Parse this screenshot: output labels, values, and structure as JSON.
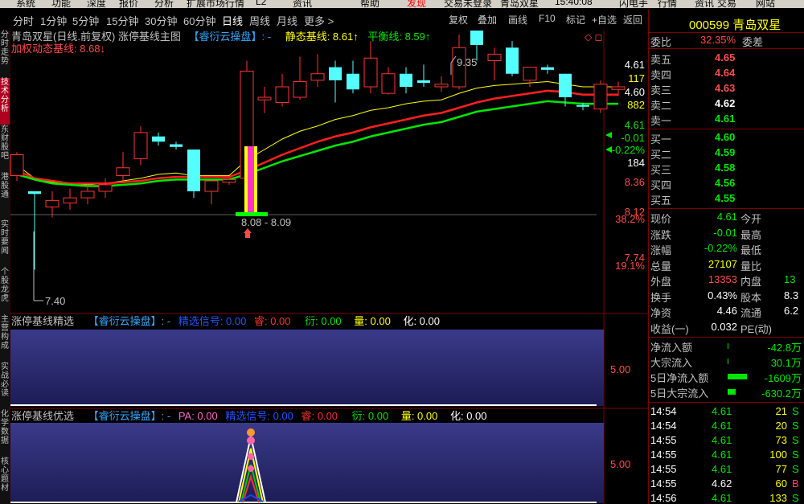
{
  "menu": [
    "系统",
    "功能",
    "深度",
    "报价",
    "分析",
    "扩展市场行情",
    "L2",
    "资讯",
    "帮助",
    "发现",
    "交易未登录",
    "青岛双星",
    "15:40:08",
    "闪电手",
    "行情",
    "资讯",
    "交易",
    "网站"
  ],
  "toolbar": {
    "periods": [
      "分时",
      "1分钟",
      "5分钟",
      "15分钟",
      "30分钟",
      "60分钟",
      "日线",
      "周线",
      "月线",
      "更多 >"
    ],
    "active_period": "日线",
    "right_buttons": [
      "复权",
      "叠加",
      "画线",
      "F10",
      "标记",
      "+自选",
      "返回"
    ]
  },
  "sidebar_tabs": [
    {
      "label": "分时走势",
      "active": false
    },
    {
      "label": "技术分析",
      "active": true
    },
    {
      "label": "东财股吧",
      "active": false
    },
    {
      "label": "港股通",
      "active": false
    },
    {
      "label": "实时要闻",
      "active": false
    },
    {
      "label": "个股龙虎",
      "active": false
    },
    {
      "label": "主营构成",
      "active": false
    },
    {
      "label": "实战必读",
      "active": false
    },
    {
      "label": "化学数据",
      "active": false
    },
    {
      "label": "核心题材",
      "active": false
    }
  ],
  "main_chart": {
    "title_line1": "青岛双星(日线.前复权) 涨停基线主图",
    "indicator_name": "【睿衍云操盘】: -",
    "static_baseline": "静态基线: 8.61↑",
    "balance_line": "平衡线: 8.59↑",
    "title_line2": "加权动态基线: 8.68↓",
    "high_annot": "9.35",
    "low_annot": "7.40",
    "box_annot": "8.08 - 8.09",
    "axis": [
      {
        "text": "4.61",
        "color": "#ffffff"
      },
      {
        "text": "117",
        "color": "#ffff00"
      },
      {
        "text": "4.60",
        "color": "#ffffff"
      },
      {
        "text": "882",
        "color": "#ffff00"
      },
      {
        "text": "4.61",
        "color": "#00e600"
      },
      {
        "text": "-0.01",
        "color": "#00e600"
      },
      {
        "text": "-0.22%",
        "color": "#00e600"
      },
      {
        "text": "184",
        "color": "#ffffff"
      },
      {
        "text": "8.36",
        "color": "#ff4a4a"
      },
      {
        "text": "8.12",
        "color": "#ff4a4a"
      },
      {
        "text": "38.2%",
        "color": "#ff4a4a"
      },
      {
        "text": "7.74",
        "color": "#ff4a4a"
      },
      {
        "text": "19.1%",
        "color": "#ff4a4a"
      }
    ]
  },
  "chart_data": {
    "type": "candlestick",
    "candles": [
      {
        "o": 8.12,
        "c": 8.28,
        "h": 8.3,
        "l": 8.08
      },
      {
        "o": 8.0,
        "c": 7.98,
        "h": 8.0,
        "l": 7.4
      },
      {
        "o": 7.88,
        "c": 7.93,
        "h": 8.0,
        "l": 7.8
      },
      {
        "o": 7.91,
        "c": 7.95,
        "h": 8.02,
        "l": 7.86
      },
      {
        "o": 7.95,
        "c": 8.0,
        "h": 8.05,
        "l": 7.9
      },
      {
        "o": 8.0,
        "c": 8.05,
        "h": 8.1,
        "l": 7.95
      },
      {
        "o": 8.12,
        "c": 8.18,
        "h": 8.3,
        "l": 8.08
      },
      {
        "o": 8.25,
        "c": 8.45,
        "h": 8.5,
        "l": 8.2
      },
      {
        "o": 8.42,
        "c": 8.38,
        "h": 8.45,
        "l": 8.35
      },
      {
        "o": 8.36,
        "c": 8.34,
        "h": 8.38,
        "l": 8.32
      },
      {
        "o": 8.32,
        "c": 8.0,
        "h": 8.32,
        "l": 7.95
      },
      {
        "o": 8.0,
        "c": 8.08,
        "h": 8.08,
        "l": 7.9
      },
      {
        "o": 8.07,
        "c": 8.09,
        "h": 8.1,
        "l": 8.05
      },
      {
        "o": 8.1,
        "c": 8.92,
        "h": 9.0,
        "l": 8.1
      },
      {
        "o": 8.7,
        "c": 8.72,
        "h": 8.8,
        "l": 8.6
      },
      {
        "o": 8.68,
        "c": 8.8,
        "h": 8.9,
        "l": 8.65
      },
      {
        "o": 8.72,
        "c": 8.84,
        "h": 9.03,
        "l": 8.7
      },
      {
        "o": 8.85,
        "c": 8.9,
        "h": 9.05,
        "l": 8.8
      },
      {
        "o": 8.95,
        "c": 8.85,
        "h": 9.0,
        "l": 8.68
      },
      {
        "o": 8.9,
        "c": 8.78,
        "h": 9.0,
        "l": 8.75
      },
      {
        "o": 8.8,
        "c": 9.02,
        "h": 9.15,
        "l": 8.75
      },
      {
        "o": 8.75,
        "c": 8.9,
        "h": 8.95,
        "l": 8.74
      },
      {
        "o": 8.9,
        "c": 8.8,
        "h": 8.95,
        "l": 8.75
      },
      {
        "o": 8.85,
        "c": 8.83,
        "h": 8.97,
        "l": 8.8
      },
      {
        "o": 8.8,
        "c": 8.82,
        "h": 8.88,
        "l": 8.76
      },
      {
        "o": 8.8,
        "c": 9.1,
        "h": 9.2,
        "l": 8.78
      },
      {
        "o": 9.28,
        "c": 9.12,
        "h": 9.35,
        "l": 9.0
      },
      {
        "o": 9.0,
        "c": 9.05,
        "h": 9.1,
        "l": 8.85
      },
      {
        "o": 9.1,
        "c": 8.9,
        "h": 9.15,
        "l": 8.88
      },
      {
        "o": 8.85,
        "c": 8.95,
        "h": 8.95,
        "l": 8.8
      },
      {
        "o": 8.95,
        "c": 8.93,
        "h": 8.97,
        "l": 8.9
      },
      {
        "o": 8.9,
        "c": 8.72,
        "h": 8.9,
        "l": 8.65
      },
      {
        "o": 8.66,
        "c": 8.65,
        "h": 8.68,
        "l": 8.62
      },
      {
        "o": 8.63,
        "c": 8.82,
        "h": 8.85,
        "l": 8.6
      },
      {
        "o": 8.78,
        "c": 8.8,
        "h": 8.84,
        "l": 8.73
      }
    ],
    "lines": {
      "yellow": [
        8.2,
        8.1,
        8.07,
        8.05,
        8.05,
        8.06,
        8.08,
        8.1,
        8.13,
        8.14,
        8.12,
        8.12,
        8.12,
        8.24,
        8.32,
        8.4,
        8.46,
        8.5,
        8.55,
        8.58,
        8.62,
        8.64,
        8.67,
        8.69,
        8.7,
        8.75,
        8.79,
        8.81,
        8.82,
        8.83,
        8.84,
        8.82,
        8.8,
        8.8,
        8.8
      ],
      "red": [
        8.16,
        8.1,
        8.08,
        8.06,
        8.06,
        8.06,
        8.07,
        8.08,
        8.1,
        8.11,
        8.11,
        8.11,
        8.11,
        8.16,
        8.22,
        8.28,
        8.33,
        8.38,
        8.42,
        8.45,
        8.49,
        8.52,
        8.55,
        8.58,
        8.6,
        8.64,
        8.68,
        8.71,
        8.73,
        8.75,
        8.77,
        8.76,
        8.74,
        8.74,
        8.74
      ],
      "green": [
        8.13,
        8.09,
        8.06,
        8.05,
        8.04,
        8.04,
        8.05,
        8.06,
        8.08,
        8.09,
        8.09,
        8.09,
        8.09,
        8.13,
        8.18,
        8.23,
        8.27,
        8.31,
        8.35,
        8.38,
        8.42,
        8.45,
        8.48,
        8.51,
        8.53,
        8.57,
        8.61,
        8.63,
        8.65,
        8.67,
        8.69,
        8.68,
        8.67,
        8.67,
        8.67
      ]
    }
  },
  "sub1": {
    "title": "涨停基线精选",
    "indicator": "【睿衍云操盘】: -",
    "signal": "精选信号: 0.00",
    "rui": "睿: 0.00",
    "yan": "衍: 0.00",
    "liang": "量: 0.00",
    "hua": "化: 0.00",
    "axis": "5.00"
  },
  "sub2": {
    "title": "涨停基线优选",
    "indicator": "【睿衍云操盘】: -",
    "pa": "PA: 0.00",
    "signal": "精选信号: 0.00",
    "rui": "睿: 0.00",
    "yan": "衍: 0.00",
    "liang": "量: 0.00",
    "hua": "化: 0.00",
    "axis": "5.00"
  },
  "quote": {
    "code": "000599",
    "name": "青岛双星",
    "weibi_label": "委比",
    "weibi_value": "32.35%",
    "weicha_label": "委差",
    "sells": [
      {
        "label": "卖五",
        "price": "4.65",
        "color": "#ff4a4a"
      },
      {
        "label": "卖四",
        "price": "4.64",
        "color": "#ff4a4a"
      },
      {
        "label": "卖三",
        "price": "4.63",
        "color": "#ff4a4a"
      },
      {
        "label": "卖二",
        "price": "4.62",
        "color": "#ffffff"
      },
      {
        "label": "卖一",
        "price": "4.61",
        "color": "#00e600"
      }
    ],
    "buys": [
      {
        "label": "买一",
        "price": "4.60",
        "color": "#00e600"
      },
      {
        "label": "买二",
        "price": "4.59",
        "color": "#00e600"
      },
      {
        "label": "买三",
        "price": "4.58",
        "color": "#00e600"
      },
      {
        "label": "买四",
        "price": "4.56",
        "color": "#00e600"
      },
      {
        "label": "买五",
        "price": "4.55",
        "color": "#00e600"
      }
    ],
    "stats": [
      {
        "l1": "现价",
        "v1": "4.61",
        "c1": "#00e600",
        "l2": "今开",
        "v2": "",
        "c2": "#00e600"
      },
      {
        "l1": "涨跌",
        "v1": "-0.01",
        "c1": "#00e600",
        "l2": "最高",
        "v2": "",
        "c2": "#ff4a4a"
      },
      {
        "l1": "涨幅",
        "v1": "-0.22%",
        "c1": "#00e600",
        "l2": "最低",
        "v2": "",
        "c2": "#00e600"
      },
      {
        "l1": "总量",
        "v1": "27107",
        "c1": "#ffff00",
        "l2": "量比",
        "v2": "",
        "c2": "#ffffff"
      },
      {
        "l1": "外盘",
        "v1": "13353",
        "c1": "#ff4a4a",
        "l2": "内盘",
        "v2": "13",
        "c2": "#00e600"
      },
      {
        "l1": "换手",
        "v1": "0.43%",
        "c1": "#ffffff",
        "l2": "股本",
        "v2": "8.3",
        "c2": "#ffffff"
      },
      {
        "l1": "净资",
        "v1": "4.46",
        "c1": "#ffffff",
        "l2": "流通",
        "v2": "6.2",
        "c2": "#ffffff"
      },
      {
        "l1": "收益(一)",
        "v1": "0.032",
        "c1": "#ffffff",
        "l2": "PE(动)",
        "v2": "",
        "c2": "#ffffff"
      }
    ],
    "flows": [
      {
        "label": "净流入额",
        "value": "-42.8万",
        "bar": 0.02
      },
      {
        "label": "大宗流入",
        "value": "30.1万",
        "bar": 0.02
      },
      {
        "label": "5日净流入额",
        "value": "-1609万",
        "bar": 0.6
      },
      {
        "label": "5日大宗流入",
        "value": "-630.2万",
        "bar": 0.25
      }
    ],
    "ticks": [
      {
        "time": "14:54",
        "price": "4.61",
        "pc": "#00e600",
        "vol": "21",
        "dir": "S",
        "dc": "#00e600"
      },
      {
        "time": "14:54",
        "price": "4.61",
        "pc": "#00e600",
        "vol": "20",
        "dir": "S",
        "dc": "#00e600"
      },
      {
        "time": "14:55",
        "price": "4.61",
        "pc": "#00e600",
        "vol": "73",
        "dir": "S",
        "dc": "#00e600"
      },
      {
        "time": "14:55",
        "price": "4.61",
        "pc": "#00e600",
        "vol": "100",
        "dir": "S",
        "dc": "#00e600"
      },
      {
        "time": "14:55",
        "price": "4.61",
        "pc": "#00e600",
        "vol": "77",
        "dir": "S",
        "dc": "#00e600"
      },
      {
        "time": "14:55",
        "price": "4.62",
        "pc": "#ffffff",
        "vol": "60",
        "dir": "B",
        "dc": "#ff4a4a"
      },
      {
        "time": "14:56",
        "price": "4.61",
        "pc": "#00e600",
        "vol": "133",
        "dir": "S",
        "dc": "#00e600"
      }
    ]
  }
}
